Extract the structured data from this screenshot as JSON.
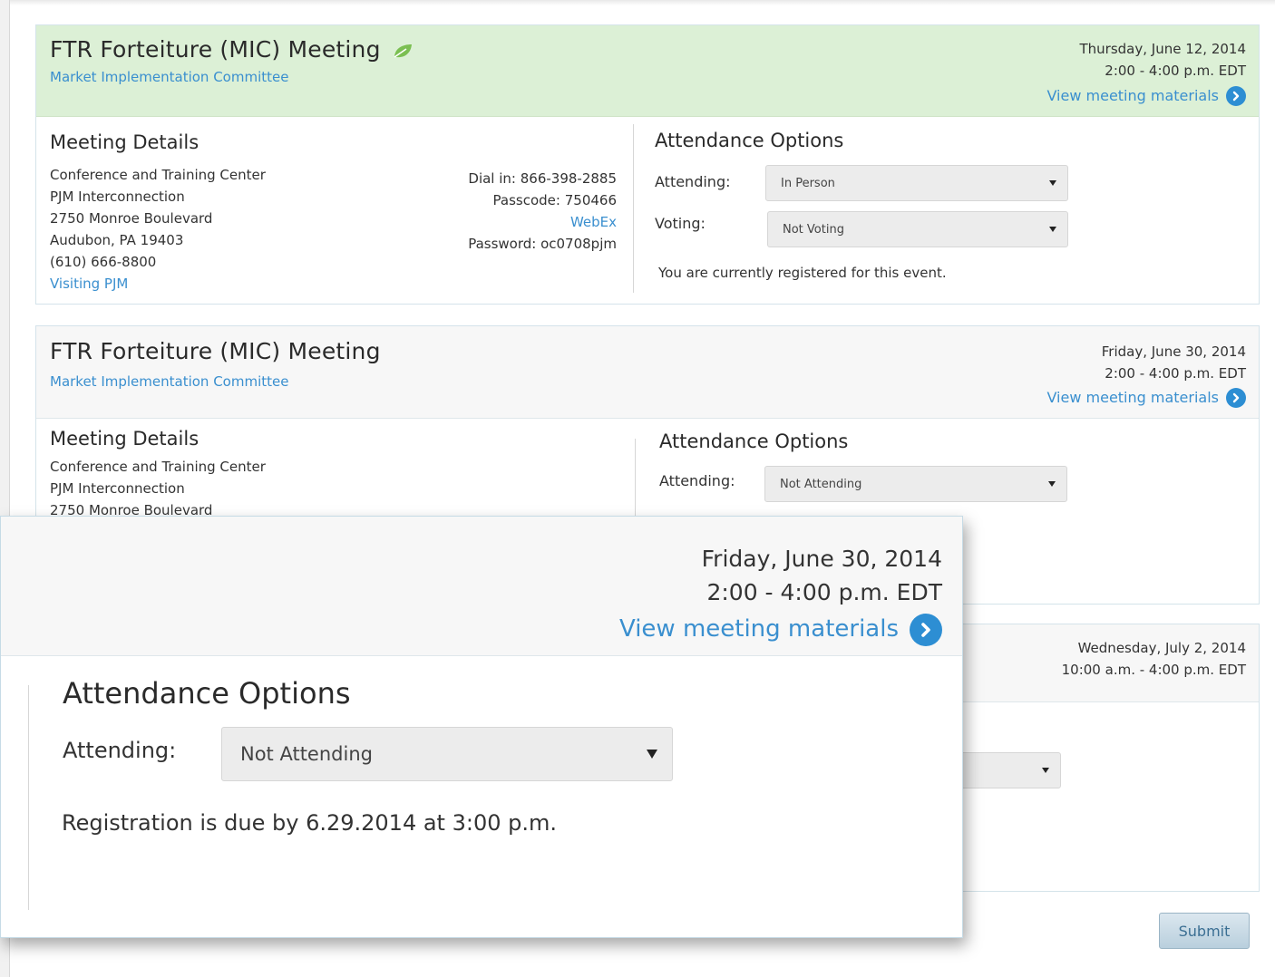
{
  "meeting1": {
    "title": "FTR Forteiture (MIC) Meeting",
    "committee": "Market Implementation Committee",
    "date": "Thursday, June 12, 2014",
    "time": "2:00  - 4:00 p.m. EDT",
    "materials_link": "View meeting materials",
    "details_title": "Meeting Details",
    "address": [
      "Conference and Training Center",
      "PJM Interconnection",
      "2750 Monroe Boulevard",
      "Audubon, PA 19403",
      "(610) 666-8800"
    ],
    "visiting_link": "Visiting PJM",
    "dial_in": "Dial in: 866-398-2885",
    "passcode": "Passcode: 750466",
    "webex_link": "WebEx",
    "password": "Password: oc0708pjm",
    "attendance_title": "Attendance Options",
    "attending_label": "Attending:",
    "attending_value": "In Person",
    "voting_label": "Voting:",
    "voting_value": "Not Voting",
    "status": "You are currently registered for this event."
  },
  "meeting2": {
    "title": "FTR Forteiture (MIC) Meeting",
    "committee": "Market Implementation Committee",
    "date": "Friday, June 30, 2014",
    "time": "2:00 - 4:00 p.m. EDT",
    "materials_link": "View meeting materials",
    "details_title": "Meeting Details",
    "address": [
      "Conference and Training Center",
      "PJM Interconnection",
      "2750 Monroe Boulevard"
    ],
    "attendance_title": "Attendance Options",
    "attending_label": "Attending:",
    "attending_value": "Not Attending"
  },
  "meeting3": {
    "date": "Wednesday, July 2, 2014",
    "time": "10:00 a.m. - 4:00 p.m. EDT"
  },
  "zoom": {
    "date": "Friday, June 30, 2014",
    "time": "2:00 - 4:00 p.m. EDT",
    "materials_link": "View meeting materials",
    "attendance_title": "Attendance Options",
    "attending_label": "Attending:",
    "attending_value": "Not Attending",
    "status": "Registration is due by 6.29.2014 at 3:00 p.m."
  },
  "submit_label": "Submit",
  "colors": {
    "accent": "#3a8fcf",
    "header_green": "#dcf0d6",
    "arrow_blue": "#2d8ed3"
  },
  "icons": {
    "materials": "chevron-right-circle-icon",
    "green": "leaf-icon"
  }
}
